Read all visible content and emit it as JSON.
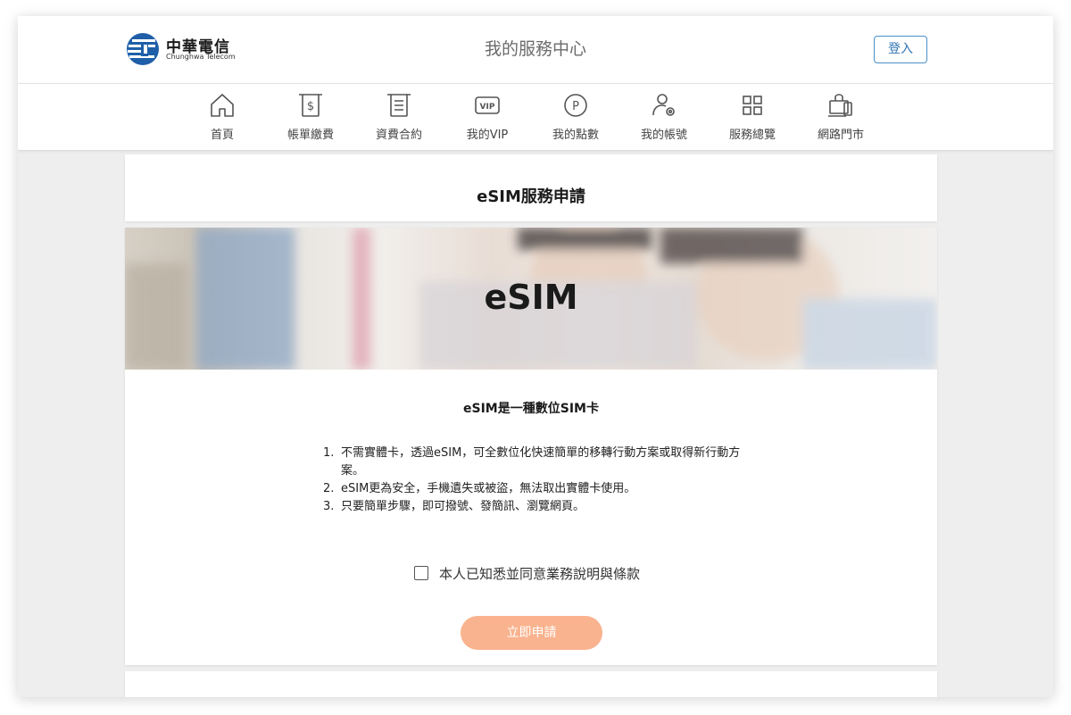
{
  "header": {
    "logo_zh": "中華電信",
    "logo_en": "Chunghwa Telecom",
    "title": "我的服務中心",
    "login_label": "登入"
  },
  "nav": {
    "items": [
      {
        "label": "首頁",
        "icon": "home-icon"
      },
      {
        "label": "帳單繳費",
        "icon": "bill-icon"
      },
      {
        "label": "資費合約",
        "icon": "contract-icon"
      },
      {
        "label": "我的VIP",
        "icon": "vip-icon"
      },
      {
        "label": "我的點數",
        "icon": "points-icon"
      },
      {
        "label": "我的帳號",
        "icon": "account-icon"
      },
      {
        "label": "服務總覽",
        "icon": "services-grid-icon"
      },
      {
        "label": "網路門市",
        "icon": "online-store-icon"
      }
    ]
  },
  "main": {
    "page_title": "eSIM服務申請",
    "banner_text": "eSIM",
    "subtitle": "eSIM是一種數位SIM卡",
    "points": [
      {
        "num": "1.",
        "text": "不需實體卡，透過eSIM，可全數位化快速簡單的移轉行動方案或取得新行動方案。"
      },
      {
        "num": "2.",
        "text": "eSIM更為安全，手機遺失或被盜，無法取出實體卡使用。"
      },
      {
        "num": "3.",
        "text": "只要簡單步驟，即可撥號、發簡訊、瀏覽網頁。"
      }
    ],
    "agree_label": "本人已知悉並同意業務說明與條款",
    "agree_checked": false,
    "apply_label": "立即申請"
  },
  "colors": {
    "brand_blue": "#2f74b5",
    "apply_button": "#f9b38e",
    "background": "#eeeeee"
  }
}
